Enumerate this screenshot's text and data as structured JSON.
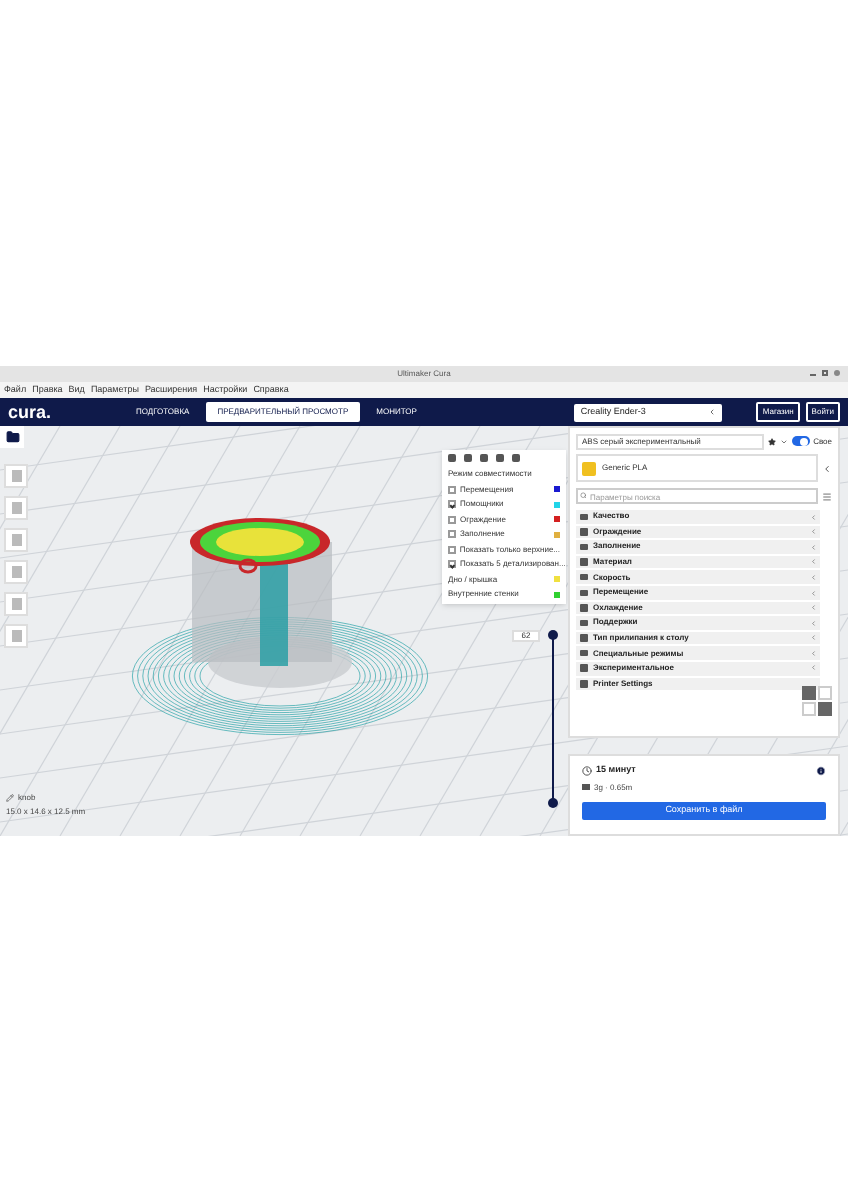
{
  "window": {
    "title": "Ultimaker Cura"
  },
  "menu": [
    "Файл",
    "Правка",
    "Вид",
    "Параметры",
    "Расширения",
    "Настройки",
    "Справка"
  ],
  "header": {
    "logo": "cura.",
    "tabs": [
      {
        "label": "ПОДГОТОВКА",
        "selected": false
      },
      {
        "label": "ПРЕДВАРИТЕЛЬНЫЙ ПРОСМОТР",
        "selected": true
      },
      {
        "label": "МОНИТОР",
        "selected": false
      }
    ],
    "printer": "Creality Ender-3",
    "buttons": [
      "Магазин",
      "Войти"
    ]
  },
  "color_scheme": {
    "title": "Режим совместимости",
    "items": [
      {
        "kind": "checkbox",
        "label": "Перемещения",
        "checked": false,
        "color": "#1a1ad0"
      },
      {
        "kind": "checkbox",
        "label": "Помощники",
        "checked": true,
        "color": "#22d4e8"
      },
      {
        "kind": "checkbox",
        "label": "Ограждение",
        "checked": false,
        "color": "#d42020"
      },
      {
        "kind": "checkbox",
        "label": "Заполнение",
        "checked": false,
        "color": "#e0b040"
      },
      {
        "kind": "checkbox",
        "label": "Показать только верхние...",
        "checked": false
      },
      {
        "kind": "checkbox",
        "label": "Показать 5 детализирован...",
        "checked": true
      },
      {
        "kind": "legend",
        "label": "Дно / крышка",
        "color": "#f0e040"
      },
      {
        "kind": "legend",
        "label": "Внутренние стенки",
        "color": "#30d030"
      }
    ]
  },
  "layer_slider": {
    "value": "62",
    "level": 1
  },
  "model": {
    "name": "knob",
    "dimensions": "15.0 x 14.6 x 12.5 mm"
  },
  "print_setup": {
    "profile": "ABS серый экспериментальный",
    "custom_label": "Свое",
    "custom_on": true,
    "material": "Generic PLA",
    "search": {
      "placeholder": "Параметры поиска"
    },
    "categories": [
      {
        "label": "Качество",
        "expandable": true
      },
      {
        "label": "Ограждение",
        "expandable": true
      },
      {
        "label": "Заполнение",
        "expandable": true
      },
      {
        "label": "Материал",
        "expandable": true
      },
      {
        "label": "Скорость",
        "expandable": true
      },
      {
        "label": "Перемещение",
        "expandable": true
      },
      {
        "label": "Охлаждение",
        "expandable": true
      },
      {
        "label": "Поддержки",
        "expandable": true
      },
      {
        "label": "Тип прилипания к столу",
        "expandable": true
      },
      {
        "label": "Специальные режимы",
        "expandable": true
      },
      {
        "label": "Экспериментальное",
        "expandable": true
      },
      {
        "label": "Printer Settings",
        "expandable": false
      }
    ]
  },
  "job": {
    "time": "15 минут",
    "material_usage": "3g · 0.65m",
    "button": "Сохранить в файл"
  }
}
